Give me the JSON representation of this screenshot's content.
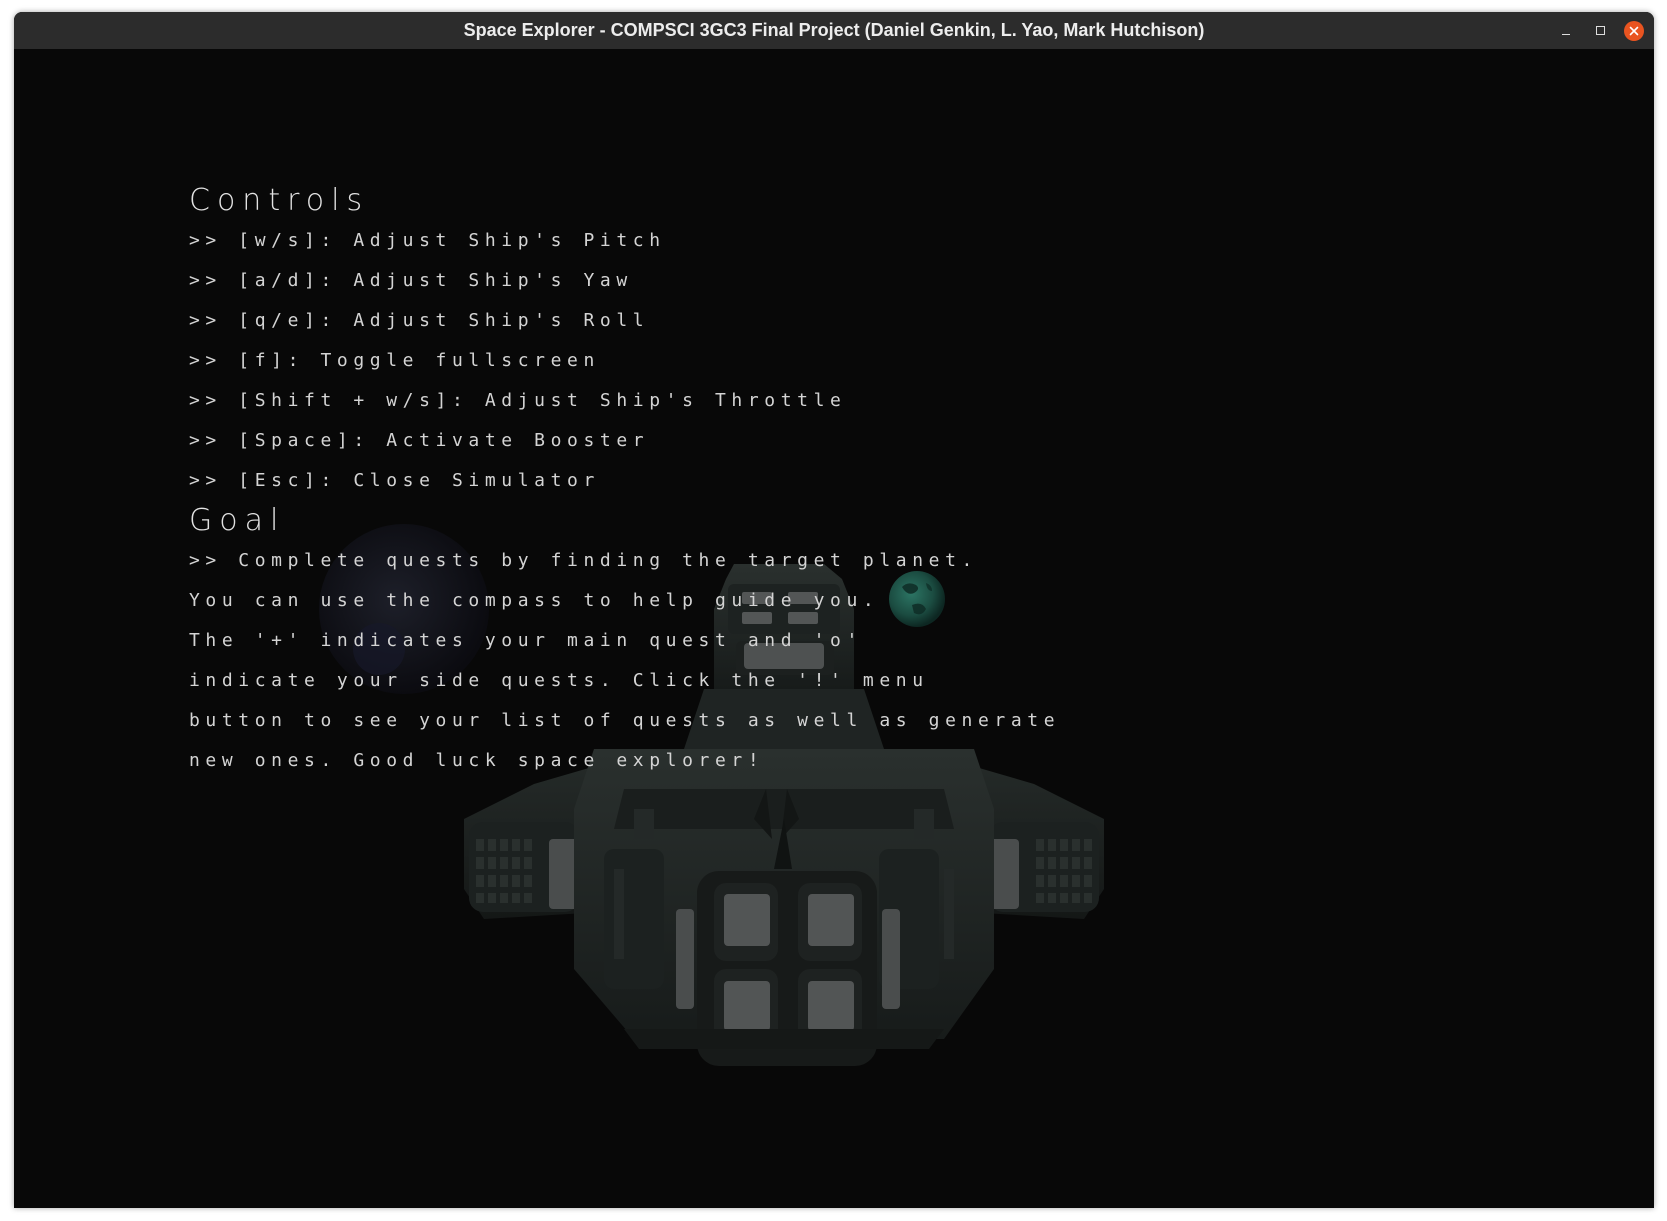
{
  "window": {
    "title": "Space Explorer - COMPSCI 3GC3 Final Project (Daniel Genkin, L. Yao, Mark Hutchison)",
    "controls": {
      "minimize_icon": "minimize-icon",
      "maximize_icon": "maximize-icon",
      "close_icon": "close-icon",
      "close_color": "#e95420"
    }
  },
  "colors": {
    "background": "#080808",
    "text": "#d4d4d4",
    "titlebar": "#2c2c2c",
    "ship_hull": "#252b29",
    "planet_green": "#1f5a4d"
  },
  "hud": {
    "controls": {
      "heading": "Controls",
      "lines": [
        ">> [w/s]: Adjust Ship's Pitch",
        ">> [a/d]: Adjust Ship's Yaw",
        ">> [q/e]: Adjust Ship's Roll",
        ">> [f]: Toggle fullscreen",
        ">> [Shift + w/s]: Adjust Ship's Throttle",
        ">> [Space]: Activate Booster",
        ">> [Esc]: Close Simulator"
      ]
    },
    "goal": {
      "heading": "Goal",
      "lines": [
        ">> Complete quests by finding the target planet.",
        "You can use the compass to help guide you.",
        "The '+' indicates your main quest and 'o'",
        "indicate your side quests. Click the '!' menu",
        "button to see your list of quests as well as generate",
        "new ones. Good luck space explorer!"
      ]
    }
  }
}
